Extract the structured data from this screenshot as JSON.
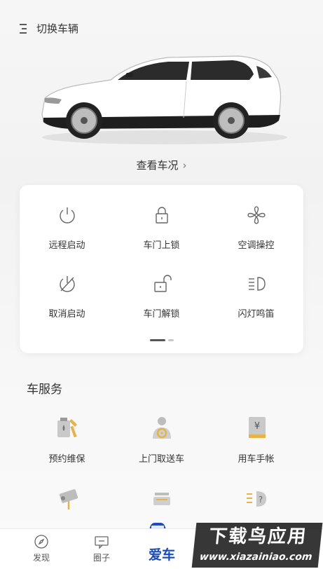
{
  "header": {
    "menu_icon": "menu-lines-icon",
    "switch_label": "切换车辆"
  },
  "vehicle": {
    "status_link": "查看车况",
    "status_chevron": "›"
  },
  "controls": [
    {
      "label": "远程启动",
      "icon": "power-icon"
    },
    {
      "label": "车门上锁",
      "icon": "lock-icon"
    },
    {
      "label": "空调操控",
      "icon": "fan-icon"
    },
    {
      "label": "取消启动",
      "icon": "power-off-icon"
    },
    {
      "label": "车门解锁",
      "icon": "unlock-icon"
    },
    {
      "label": "闪灯鸣笛",
      "icon": "headlight-icon"
    }
  ],
  "services": {
    "title": "车服务",
    "items": [
      {
        "label": "预约维保",
        "icon": "maintenance-icon"
      },
      {
        "label": "上门取送车",
        "icon": "driver-icon"
      },
      {
        "label": "用车手帐",
        "icon": "ledger-icon"
      },
      {
        "label": "",
        "icon": "camera-icon"
      },
      {
        "label": "",
        "icon": "dashcam-icon"
      },
      {
        "label": "",
        "icon": "headlight-help-icon"
      }
    ]
  },
  "tabbar": {
    "tabs": [
      {
        "label": "发现",
        "icon": "compass-icon"
      },
      {
        "label": "圈子",
        "icon": "chat-icon"
      },
      {
        "label": "爱车",
        "icon": "car-icon",
        "active": true
      }
    ],
    "active_color": "#1a4db5"
  },
  "watermark": {
    "main": "下载鸟应用",
    "sub": "www.xiazainiao.com"
  }
}
